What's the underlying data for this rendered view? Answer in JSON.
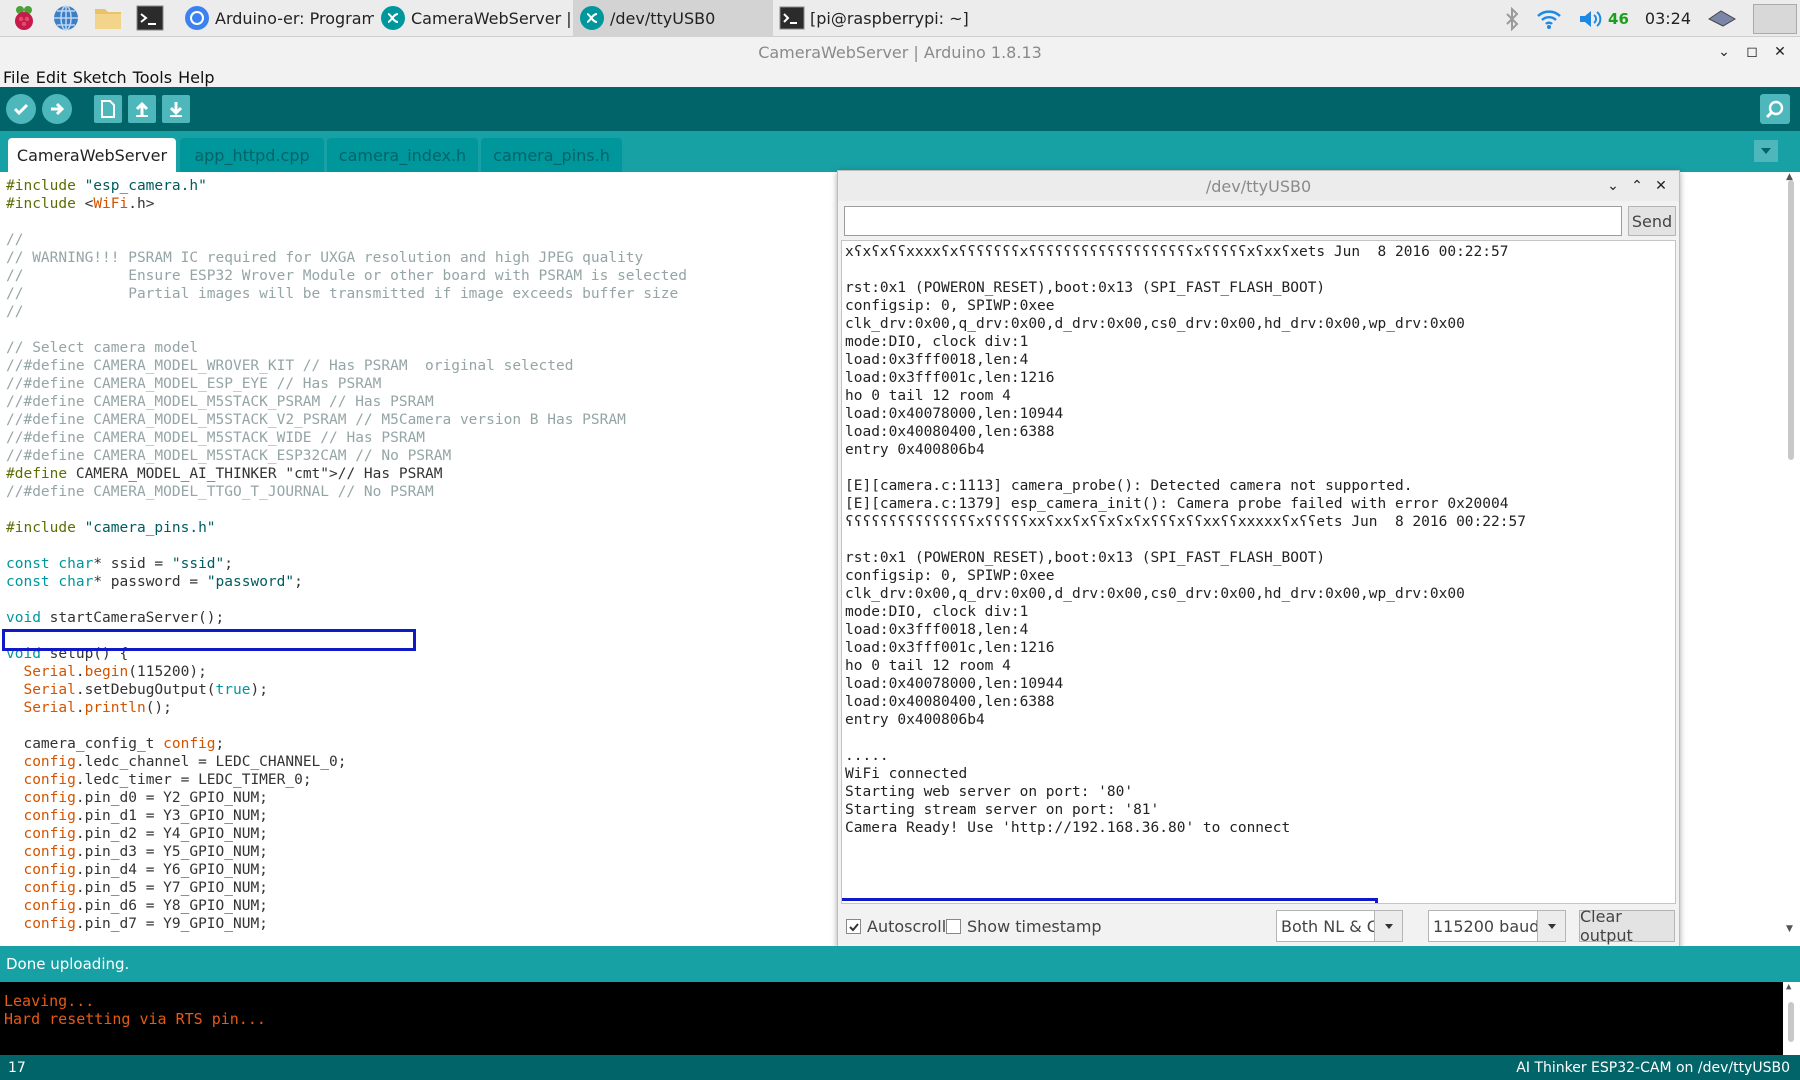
{
  "taskbar": {
    "tasks": [
      {
        "label": "Arduino-er: Program ..."
      },
      {
        "label": "CameraWebServer | A..."
      },
      {
        "label": "/dev/ttyUSB0"
      },
      {
        "label": "[pi@raspberrypi: ~]"
      }
    ],
    "volume": "46",
    "clock": "03:24"
  },
  "window": {
    "title": "CameraWebServer | Arduino 1.8.13"
  },
  "menu": [
    "File",
    "Edit",
    "Sketch",
    "Tools",
    "Help"
  ],
  "tabs": [
    "CameraWebServer",
    "app_httpd.cpp",
    "camera_index.h",
    "camera_pins.h"
  ],
  "editor": {
    "lines": [
      "#include \"esp_camera.h\"",
      "#include <WiFi.h>",
      "",
      "//",
      "// WARNING!!! PSRAM IC required for UXGA resolution and high JPEG quality",
      "//            Ensure ESP32 Wrover Module or other board with PSRAM is selected",
      "//            Partial images will be transmitted if image exceeds buffer size",
      "//",
      "",
      "// Select camera model",
      "//#define CAMERA_MODEL_WROVER_KIT // Has PSRAM  original selected",
      "//#define CAMERA_MODEL_ESP_EYE // Has PSRAM",
      "//#define CAMERA_MODEL_M5STACK_PSRAM // Has PSRAM",
      "//#define CAMERA_MODEL_M5STACK_V2_PSRAM // M5Camera version B Has PSRAM",
      "//#define CAMERA_MODEL_M5STACK_WIDE // Has PSRAM",
      "//#define CAMERA_MODEL_M5STACK_ESP32CAM // No PSRAM",
      "#define CAMERA_MODEL_AI_THINKER // Has PSRAM",
      "//#define CAMERA_MODEL_TTGO_T_JOURNAL // No PSRAM",
      "",
      "#include \"camera_pins.h\"",
      "",
      "const char* ssid = \"ssid\";",
      "const char* password = \"password\";",
      "",
      "void startCameraServer();",
      "",
      "void setup() {",
      "  Serial.begin(115200);",
      "  Serial.setDebugOutput(true);",
      "  Serial.println();",
      "",
      "  camera_config_t config;",
      "  config.ledc_channel = LEDC_CHANNEL_0;",
      "  config.ledc_timer = LEDC_TIMER_0;",
      "  config.pin_d0 = Y2_GPIO_NUM;",
      "  config.pin_d1 = Y3_GPIO_NUM;",
      "  config.pin_d2 = Y4_GPIO_NUM;",
      "  config.pin_d3 = Y5_GPIO_NUM;",
      "  config.pin_d4 = Y6_GPIO_NUM;",
      "  config.pin_d5 = Y7_GPIO_NUM;",
      "  config.pin_d6 = Y8_GPIO_NUM;",
      "  config.pin_d7 = Y9_GPIO_NUM;"
    ]
  },
  "serial_monitor": {
    "title": "/dev/ttyUSB0",
    "send_label": "Send",
    "input_value": "",
    "output": [
      "xʕxʕxʕʕxxxxʕxʕʕʕʕʕʕʕxʕʕʕʕʕʕʕʕʕʕʕʕʕʕʕʕʕʕʕxʕʕʕʕʕxʕxxʕxets Jun  8 2016 00:22:57",
      "",
      "rst:0x1 (POWERON_RESET),boot:0x13 (SPI_FAST_FLASH_BOOT)",
      "configsip: 0, SPIWP:0xee",
      "clk_drv:0x00,q_drv:0x00,d_drv:0x00,cs0_drv:0x00,hd_drv:0x00,wp_drv:0x00",
      "mode:DIO, clock div:1",
      "load:0x3fff0018,len:4",
      "load:0x3fff001c,len:1216",
      "ho 0 tail 12 room 4",
      "load:0x40078000,len:10944",
      "load:0x40080400,len:6388",
      "entry 0x400806b4",
      "",
      "[E][camera.c:1113] camera_probe(): Detected camera not supported.",
      "[E][camera.c:1379] esp_camera_init(): Camera probe failed with error 0x20004",
      "ʕʕʕʕʕʕʕʕʕʕʕʕʕʕʕxʕʕʕʕʕxxʕxxʕxʕʕxʕxʕxʕʕʕxʕʕxxʕʕxxxxxʕxʕʕets Jun  8 2016 00:22:57",
      "",
      "rst:0x1 (POWERON_RESET),boot:0x13 (SPI_FAST_FLASH_BOOT)",
      "configsip: 0, SPIWP:0xee",
      "clk_drv:0x00,q_drv:0x00,d_drv:0x00,cs0_drv:0x00,hd_drv:0x00,wp_drv:0x00",
      "mode:DIO, clock div:1",
      "load:0x3fff0018,len:4",
      "load:0x3fff001c,len:1216",
      "ho 0 tail 12 room 4",
      "load:0x40078000,len:10944",
      "load:0x40080400,len:6388",
      "entry 0x400806b4",
      "",
      ".....",
      "WiFi connected",
      "Starting web server on port: '80'",
      "Starting stream server on port: '81'",
      "Camera Ready! Use 'http://192.168.36.80' to connect"
    ],
    "autoscroll_label": "Autoscroll",
    "autoscroll_checked": true,
    "timestamp_label": "Show timestamp",
    "timestamp_checked": false,
    "line_ending": "Both NL & CR",
    "baud": "115200 baud",
    "clear_label": "Clear output"
  },
  "status": {
    "message": "Done uploading."
  },
  "console": {
    "lines": [
      "Leaving...",
      "Hard resetting via RTS pin..."
    ]
  },
  "footer": {
    "line": "17",
    "board": "AI Thinker ESP32-CAM on /dev/ttyUSB0"
  },
  "colors": {
    "teal_dark": "#006468",
    "teal": "#17a1a5",
    "highlight_box": "#1018c8"
  }
}
